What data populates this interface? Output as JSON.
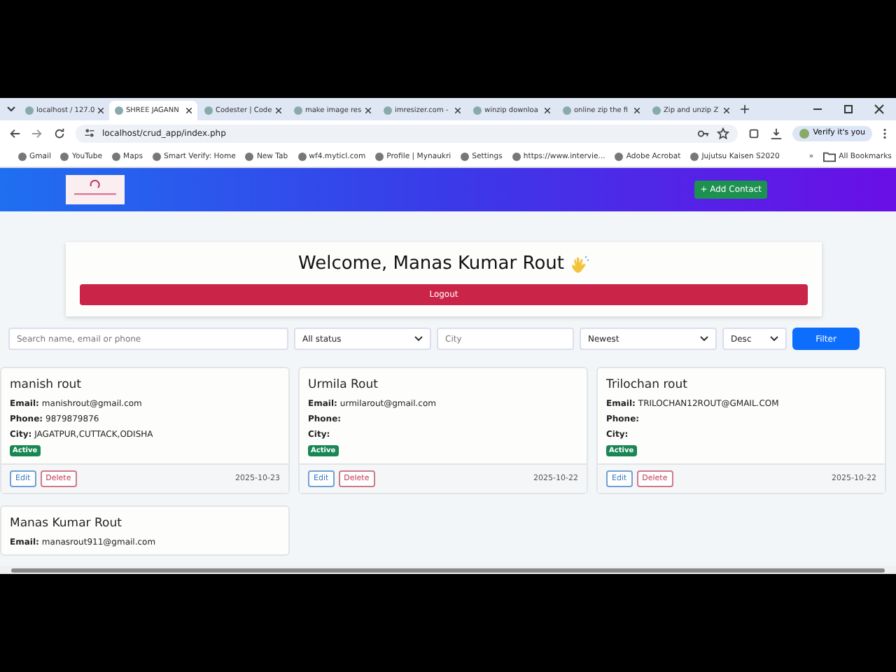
{
  "browser": {
    "tabs": [
      {
        "title": "localhost / 127.0",
        "selected": false
      },
      {
        "title": "SHREE JAGANN",
        "selected": true
      },
      {
        "title": "Codester | Code",
        "selected": false
      },
      {
        "title": "make image res",
        "selected": false
      },
      {
        "title": "imresizer.com -",
        "selected": false
      },
      {
        "title": "winzip downloa",
        "selected": false
      },
      {
        "title": "online zip the fi",
        "selected": false
      },
      {
        "title": "Zip and unzip Z",
        "selected": false
      }
    ],
    "url": "localhost/crud_app/index.php",
    "profile_button": "Verify it's you",
    "bookmarks": [
      {
        "label": "Gmail"
      },
      {
        "label": "YouTube"
      },
      {
        "label": "Maps"
      },
      {
        "label": "Smart Verify: Home"
      },
      {
        "label": "New Tab"
      },
      {
        "label": "wf4.myticl.com"
      },
      {
        "label": "Profile | Mynaukri"
      },
      {
        "label": "Settings"
      },
      {
        "label": "https://www.intervie..."
      },
      {
        "label": "Adobe Acrobat"
      },
      {
        "label": "Jujutsu Kaisen S2020"
      }
    ],
    "bookmarks_overflow": "»",
    "all_bookmarks": "All Bookmarks"
  },
  "header": {
    "add_button": "+ Add Contact"
  },
  "welcome": {
    "title": "Welcome, Manas Kumar Rout",
    "logout": "Logout"
  },
  "filters": {
    "search_placeholder": "Search name, email or phone",
    "status": "All status",
    "city_placeholder": "City",
    "sort": "Newest",
    "order": "Desc",
    "button": "Filter"
  },
  "contacts": [
    {
      "name": "manish rout",
      "fields": [
        {
          "label": "Email:",
          "value": "manishrout@gmail.com"
        },
        {
          "label": "Phone:",
          "value": "9879879876"
        },
        {
          "label": "City:",
          "value": "JAGATPUR,CUTTACK,ODISHA"
        }
      ],
      "status": "Active",
      "actions": [
        "Edit",
        "Delete"
      ],
      "date": "2025-10-23"
    },
    {
      "name": "Urmila Rout",
      "fields": [
        {
          "label": "Email:",
          "value": "urmilarout@gmail.com"
        },
        {
          "label": "Phone:"
        },
        {
          "label": "City:"
        }
      ],
      "status": "Active",
      "actions": [
        "Edit",
        "Delete"
      ],
      "date": "2025-10-22"
    },
    {
      "name": "Trilochan rout",
      "fields": [
        {
          "label": "Email:",
          "value": "TRILOCHAN12ROUT@GMAIL.COM"
        },
        {
          "label": "Phone:"
        },
        {
          "label": "City:"
        }
      ],
      "status": "Active",
      "actions": [
        "Edit",
        "Delete"
      ],
      "date": "2025-10-22"
    },
    {
      "name": "Manas Kumar Rout",
      "fields": [
        {
          "label": "Email:",
          "value": "manasrout911@gmail.com"
        }
      ]
    }
  ]
}
